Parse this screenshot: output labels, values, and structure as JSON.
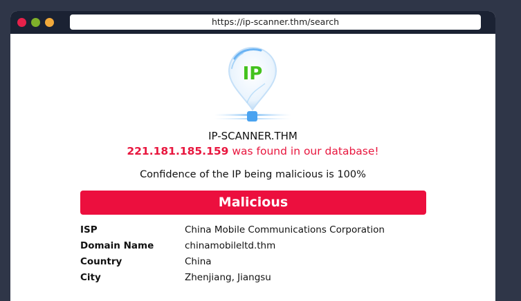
{
  "browser": {
    "url": "https://ip-scanner.thm/search",
    "dot_colors": [
      "#e6214a",
      "#7fb02a",
      "#f2a93b"
    ]
  },
  "logo": {
    "icon": "location-pin-icon",
    "text": "IP",
    "text_color": "#43c21d",
    "accent": "#4aa3f0"
  },
  "site": {
    "name": "IP-SCANNER.THM"
  },
  "result": {
    "ip": "221.181.185.159",
    "found_text": " was found in our database!",
    "confidence_text": "Confidence of the IP being malicious is 100%",
    "verdict": "Malicious",
    "verdict_color": "#ec0f3e"
  },
  "details": [
    {
      "label": "ISP",
      "value": "China Mobile Communications Corporation"
    },
    {
      "label": "Domain Name",
      "value": "chinamobileltd.thm"
    },
    {
      "label": "Country",
      "value": "China"
    },
    {
      "label": "City",
      "value": "Zhenjiang, Jiangsu"
    }
  ]
}
